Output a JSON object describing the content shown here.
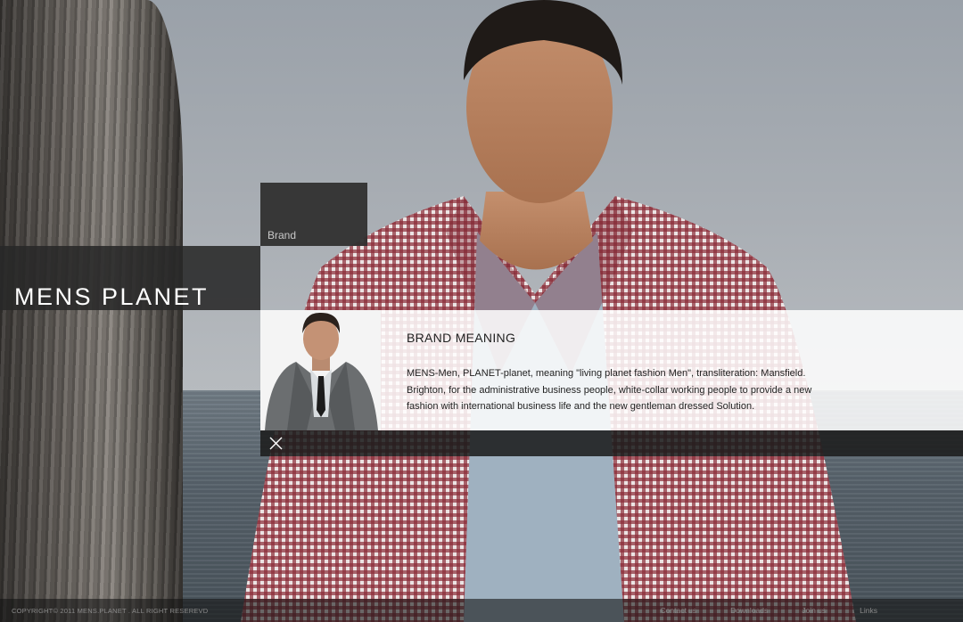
{
  "brand": {
    "logo_text": "MENS PLANET",
    "tab_label": "Brand"
  },
  "panel": {
    "title": "BRAND MEANING",
    "body": "MENS-Men, PLANET-planet, meaning \"living planet fashion Men\", transliteration: Mansfield. Brighton, for the administrative business people, white-collar working people to provide a new fashion with international business life and the new gentleman dressed Solution.",
    "close_icon": "close-icon"
  },
  "footer": {
    "copyright": "COPYRIGHT© 2011 MENS.PLANET . ALL RIGHT RESEREVD",
    "links": [
      "Contact us",
      "Downloads",
      "Join us",
      "Links"
    ]
  },
  "colors": {
    "bar_dark": "#2f2f2f",
    "panel_bg": "#ffffff",
    "text_dark": "#222222",
    "footer_text": "#8a8a8a"
  }
}
